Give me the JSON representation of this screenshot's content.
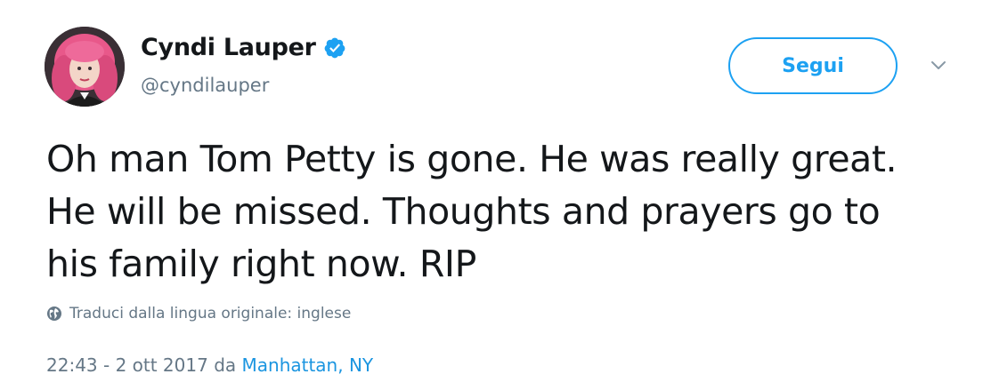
{
  "tweet": {
    "author": {
      "display_name": "Cyndi Lauper",
      "handle": "@cyndilauper",
      "verified": true
    },
    "follow_label": "Segui",
    "text": "Oh man Tom Petty is gone. He was really great. He will be missed. Thoughts and prayers go to his family right now. RIP",
    "translate_label": "Traduci dalla lingua originale: inglese",
    "timestamp": "22:43 - 2 ott 2017",
    "location_prefix": "da",
    "location": "Manhattan, NY"
  },
  "icons": {
    "verified": "verified-badge-icon",
    "caret": "chevron-down-icon",
    "globe": "globe-icon"
  },
  "colors": {
    "accent": "#1da1f2",
    "link": "#1b95e0",
    "text_primary": "#14171a",
    "text_secondary": "#657786"
  }
}
